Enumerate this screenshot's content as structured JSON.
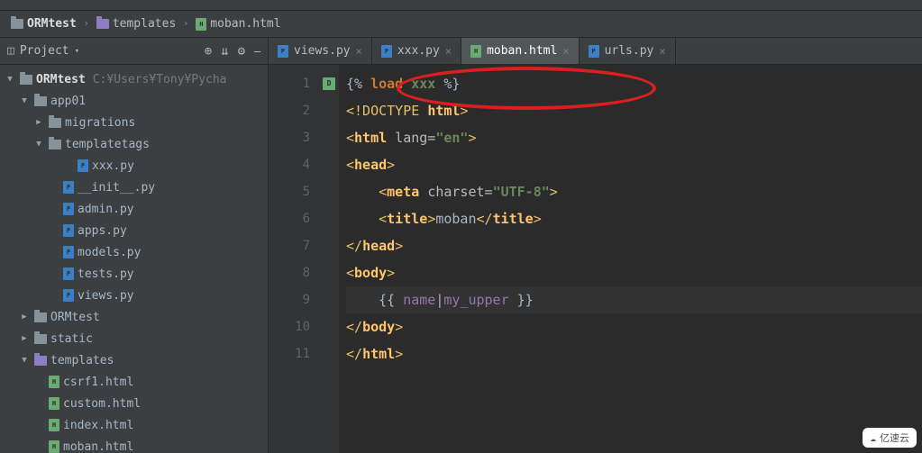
{
  "breadcrumb": {
    "project": "ORMtest",
    "folder": "templates",
    "file": "moban.html"
  },
  "project_panel": {
    "title": "Project",
    "icons": {
      "target": "⊕",
      "collapse": "⇊",
      "gear": "⚙",
      "hide": "⎯"
    }
  },
  "tree": {
    "root": {
      "name": "ORMtest",
      "path": "C:¥Users¥Tony¥Pycha"
    },
    "app01": "app01",
    "migrations": "migrations",
    "templatetags": "templatetags",
    "xxx": "xxx.py",
    "init": "__init__.py",
    "admin": "admin.py",
    "apps": "apps.py",
    "models": "models.py",
    "tests": "tests.py",
    "views": "views.py",
    "ormtest2": "ORMtest",
    "static": "static",
    "templates": "templates",
    "csrf1": "csrf1.html",
    "custom": "custom.html",
    "index": "index.html",
    "moban": "moban.html"
  },
  "tabs": {
    "t1": "views.py",
    "t2": "xxx.py",
    "t3": "moban.html",
    "t4": "urls.py"
  },
  "lines": [
    "1",
    "2",
    "3",
    "4",
    "5",
    "6",
    "7",
    "8",
    "9",
    "10",
    "11"
  ],
  "code": {
    "l1_a": "{% ",
    "l1_b": "load",
    "l1_c": " xxx ",
    "l1_d": "%}",
    "l2_a": "<!DOCTYPE ",
    "l2_b": "html",
    "l2_c": ">",
    "l3_a": "<",
    "l3_b": "html ",
    "l3_c": "lang=",
    "l3_d": "\"en\"",
    "l3_e": ">",
    "l4_a": "<",
    "l4_b": "head",
    "l4_c": ">",
    "l5_a": "    <",
    "l5_b": "meta ",
    "l5_c": "charset=",
    "l5_d": "\"UTF-8\"",
    "l5_e": ">",
    "l6_a": "    <",
    "l6_b": "title",
    "l6_c": ">",
    "l6_d": "moban",
    "l6_e": "</",
    "l6_f": "title",
    "l6_g": ">",
    "l7_a": "</",
    "l7_b": "head",
    "l7_c": ">",
    "l8_a": "<",
    "l8_b": "body",
    "l8_c": ">",
    "l9_a": "    {{ ",
    "l9_b": "name",
    "l9_c": "|",
    "l9_d": "my_upper",
    "l9_e": " }}",
    "l10_a": "</",
    "l10_b": "body",
    "l10_c": ">",
    "l11_a": "</",
    "l11_b": "html",
    "l11_c": ">"
  },
  "watermark": "亿速云"
}
